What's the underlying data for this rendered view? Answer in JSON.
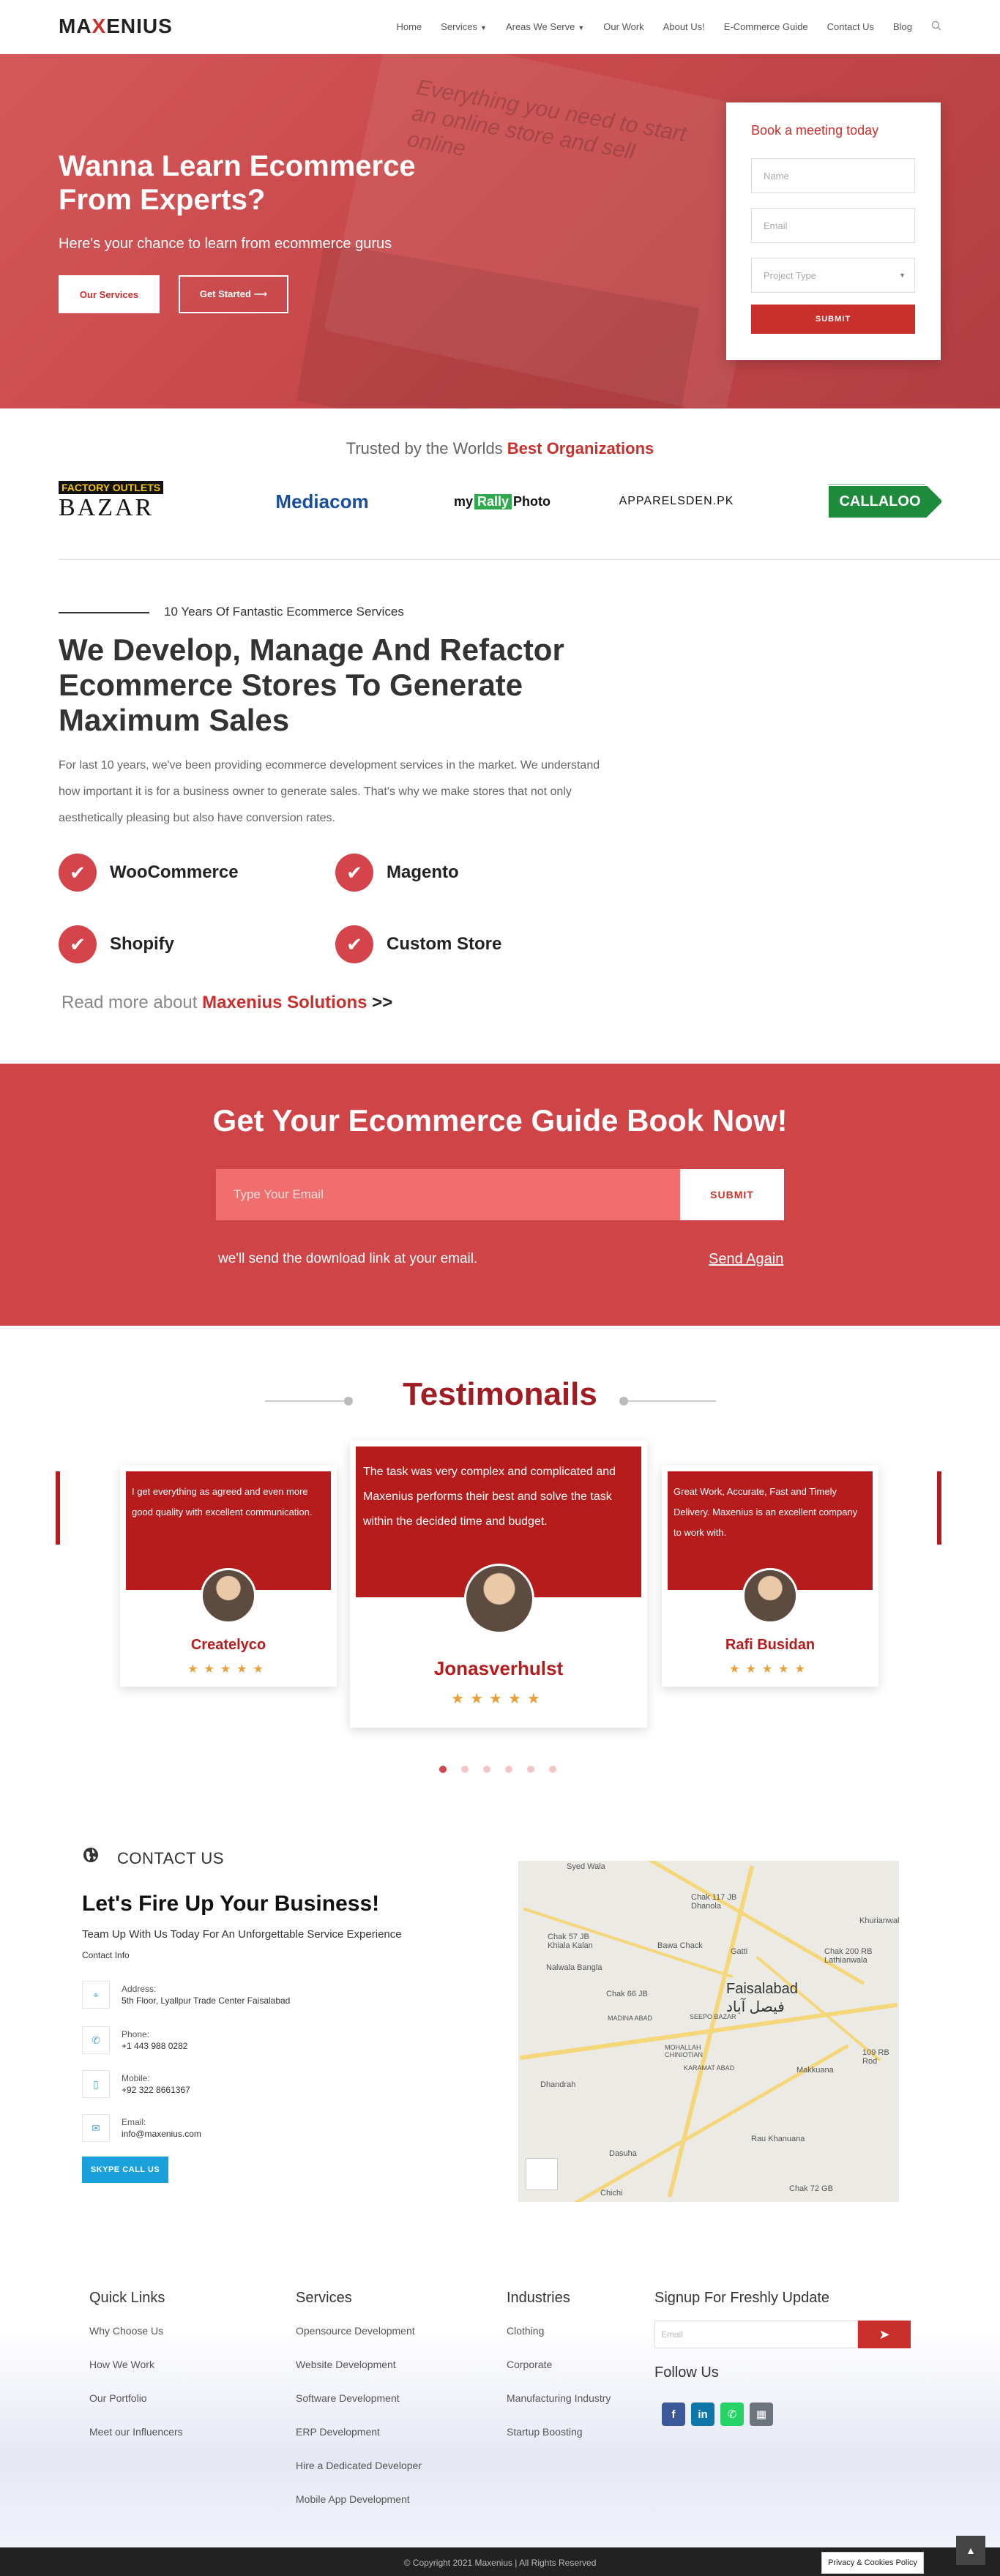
{
  "header": {
    "logo_prefix": "MA",
    "logo_x": "X",
    "logo_suffix": "ENIUS",
    "nav": [
      "Home",
      "Services",
      "Areas We Serve",
      "Our Work",
      "About Us!",
      "E-Commerce Guide",
      "Contact Us",
      "Blog"
    ],
    "search_icon": "search-icon"
  },
  "hero": {
    "title": "Wanna Learn Ecommerce From Experts?",
    "subtitle": "Here's your chance to learn from ecommerce gurus",
    "btn_services": "Our Services",
    "btn_started": "Get Started ⟶",
    "bg_text": "Everything you need to start an online store and sell online"
  },
  "booking": {
    "title": "Book a meeting today",
    "name_placeholder": "Name",
    "email_placeholder": "Email",
    "project_placeholder": "Project Type",
    "submit": "SUBMIT"
  },
  "trusted": {
    "prefix": "Trusted by the Worlds ",
    "highlight": "Best Organizations",
    "brands": {
      "bazar_top": "FACTORY OUTLETS",
      "bazar_main": "BAZAR",
      "mediacom": "Mediacom",
      "rally_1": "my",
      "rally_2": "Rally",
      "rally_3": "Photo",
      "apparel": "APPARELSDEN.PK",
      "callaloo": "CALLALOO"
    }
  },
  "about": {
    "kicker": "10 Years Of Fantastic Ecommerce Services",
    "title": "We Develop, Manage And Refactor Ecommerce Stores To Generate Maximum Sales",
    "body": "For last 10 years, we've been providing ecommerce development services in the market. We understand how important it is for a business owner to generate sales. That's why we make stores that not only aesthetically pleasing but also have conversion rates.",
    "features": [
      "WooCommerce",
      "Magento",
      "Shopify",
      "Custom Store"
    ],
    "read_prefix": "Read more about ",
    "read_link": "Maxenius Solutions",
    "read_arrows": ">>"
  },
  "guide": {
    "title": "Get Your Ecommerce Guide Book Now!",
    "email_placeholder": "Type Your Email",
    "submit": "SUBMIT",
    "note": "we'll send the download link at your email.",
    "send_again": "Send Again"
  },
  "testimonials": {
    "title": "Testimonails",
    "items": [
      {
        "quote": "I get everything as agreed and even more good quality with excellent communication.",
        "name": "Createlyco",
        "rating": 5
      },
      {
        "quote": "The task was very complex and complicated and Maxenius performs their best and solve the task within the decided time and budget.",
        "name": "Jonasverhulst",
        "rating": 5
      },
      {
        "quote": "Great Work, Accurate, Fast and Timely Delivery. Maxenius is an excellent company to work with.",
        "name": "Rafi Busidan",
        "rating": 5
      }
    ],
    "pages": 6,
    "active_page": 1
  },
  "contact": {
    "heading": "CONTACT US",
    "title": "Let's Fire Up Your Business!",
    "subtitle": "Team Up With Us Today For An Unforgettable Service Experience",
    "info_label": "Contact Info",
    "items": [
      {
        "label": "Address:",
        "value": "5th Floor, Lyallpur Trade Center Faisalabad",
        "icon": "map-pin-icon"
      },
      {
        "label": "Phone:",
        "value": "+1 443 988 0282",
        "icon": "phone-icon"
      },
      {
        "label": "Mobile:",
        "value": "+92 322 8661367",
        "icon": "mobile-icon"
      },
      {
        "label": "Email:",
        "value": "info@maxenius.com",
        "icon": "email-icon"
      }
    ],
    "skype": "SKYPE CALL US",
    "map": {
      "city": "Faisalabad",
      "city_urdu": "فیصل آباد",
      "labels": [
        "Syed Wala",
        "Chak 117 JB Dhanola",
        "Chak 57 JB Khiala Kalan",
        "Bawa Chack",
        "Gatti",
        "Khurianwala",
        "Chak 200 RB Lathianwala",
        "Nalwala Bangla",
        "Chak 66 JB",
        "MADINA ABAD",
        "SEEPO BAZAR",
        "MOHALLAH CHINIOTIAN",
        "KARAMAT ABAD",
        "Dhandrah",
        "Makkuana",
        "109 RB Rod",
        "Dasuha",
        "Rau Khanuana",
        "Chak 72 GB",
        "Chichi"
      ]
    }
  },
  "footer": {
    "quick_links_title": "Quick Links",
    "quick_links": [
      "Why Choose Us",
      "How We Work",
      "Our Portfolio",
      "Meet our Influencers"
    ],
    "services_title": "Services",
    "services": [
      "Opensource Development",
      "Website Development",
      "Software Development",
      "ERP Development",
      "Hire a Dedicated Developer",
      "Mobile App Development"
    ],
    "industries_title": "Industries",
    "industries": [
      "Clothing",
      "Corporate",
      "Manufacturing Industry",
      "Startup Boosting"
    ],
    "signup_title": "Signup For Freshly Update",
    "signup_placeholder": "Email",
    "follow_title": "Follow Us",
    "social": [
      {
        "name": "facebook-icon",
        "glyph": "f",
        "color": "#3b5998"
      },
      {
        "name": "linkedin-icon",
        "glyph": "in",
        "color": "#0e76a8"
      },
      {
        "name": "whatsapp-icon",
        "glyph": "✆",
        "color": "#25d366"
      },
      {
        "name": "calendar-icon",
        "glyph": "▦",
        "color": "#6c757d"
      }
    ],
    "copyright": "© Copyright 2021 Maxenius | All Rights Reserved",
    "privacy": "Privacy & Cookies Policy"
  },
  "colors": {
    "brand": "#c9302c",
    "accent_dark": "#a01c22",
    "skype": "#1aa1dc"
  }
}
